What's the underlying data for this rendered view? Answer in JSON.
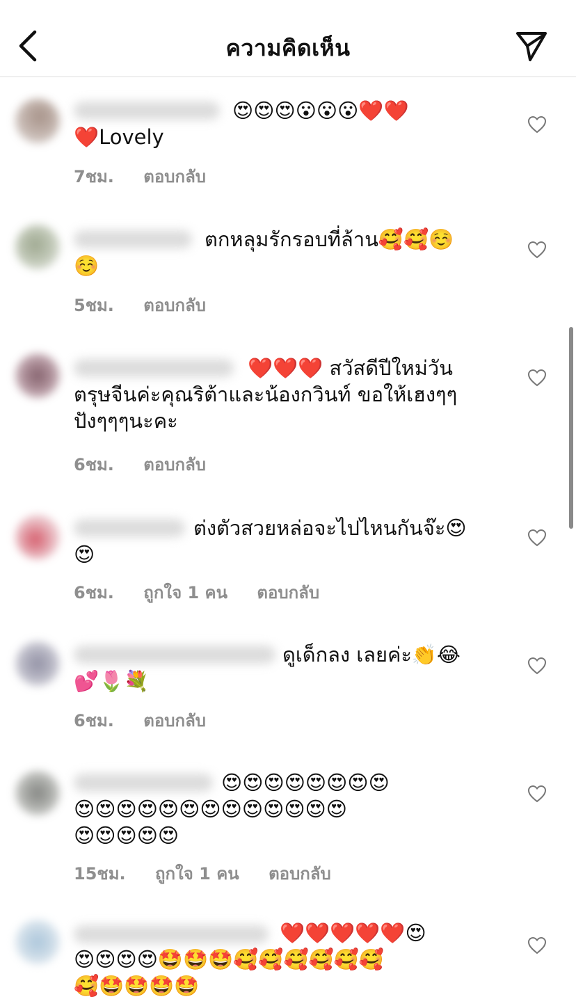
{
  "header": {
    "title": "ความคิดเห็น",
    "back_icon": "chevron-left-icon",
    "send_icon": "paper-plane-icon"
  },
  "comments": [
    {
      "text": "😍😍😍😮😮😮❤️❤️\n❤️Lovely",
      "time": "7ชม.",
      "likes": "",
      "reply": "ตอบกลับ"
    },
    {
      "text": "ตกหลุมรักรอบที่ล้าน🥰🥰☺️\n☺️",
      "time": "5ชม.",
      "likes": "",
      "reply": "ตอบกลับ"
    },
    {
      "text": "❤️❤️❤️ สวัสดีปีใหม่วัน\nตรุษจีนค่ะคุณริต้าและน้องกวินท์ ขอให้เฮงๆๆ\nปังๆๆๆนะคะ",
      "time": "6ชม.",
      "likes": "",
      "reply": "ตอบกลับ"
    },
    {
      "text": "ต่งตัวสวยหล่อจะไปไหนกันจ๊ะ😍\n😍",
      "time": "6ชม.",
      "likes": "ถูกใจ 1 คน",
      "reply": "ตอบกลับ"
    },
    {
      "text": "ดูเด็กลง เลยค่ะ👏😂\n💕🌷💐",
      "time": "6ชม.",
      "likes": "",
      "reply": "ตอบกลับ"
    },
    {
      "text": "😍😍😍😍😍😍😍😍\n😍😍😍😍😍😍😍😍😍😍😍😍😍\n😍😍😍😍😍",
      "time": "15ชม.",
      "likes": "ถูกใจ 1 คน",
      "reply": "ตอบกลับ"
    },
    {
      "text": "❤️❤️❤️❤️❤️😍\n😍😍😍😍🤩🤩🤩🥰🥰🥰🥰🥰🥰\n🥰🤩🤩🤩🤩",
      "time": "",
      "likes": "",
      "reply": ""
    }
  ],
  "icons": {
    "like": "heart-outline-icon"
  }
}
